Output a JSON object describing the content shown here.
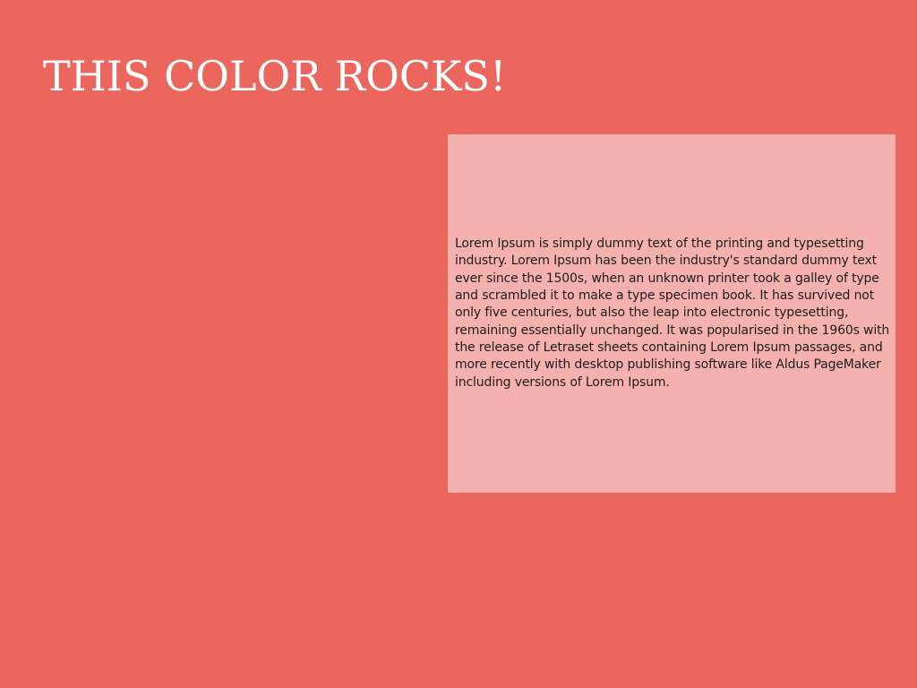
{
  "page": {
    "background_color": "#eb665c",
    "title": "THIS COLOR ROCKS!"
  },
  "text_box": {
    "background_color": "#f5b1ad",
    "body": "Lorem Ipsum is simply dummy text of the printing and typesetting industry. Lorem Ipsum has been the industry's standard dummy text ever since the 1500s, when an unknown printer took a galley of type and scrambled it to make a type specimen book. It has survived not only five centuries, but also the leap into electronic typesetting, remaining essentially unchanged. It was popularised in the 1960s with the release of Letraset sheets containing Lorem Ipsum passages, and more recently with desktop publishing software like Aldus PageMaker including versions of Lorem Ipsum."
  }
}
